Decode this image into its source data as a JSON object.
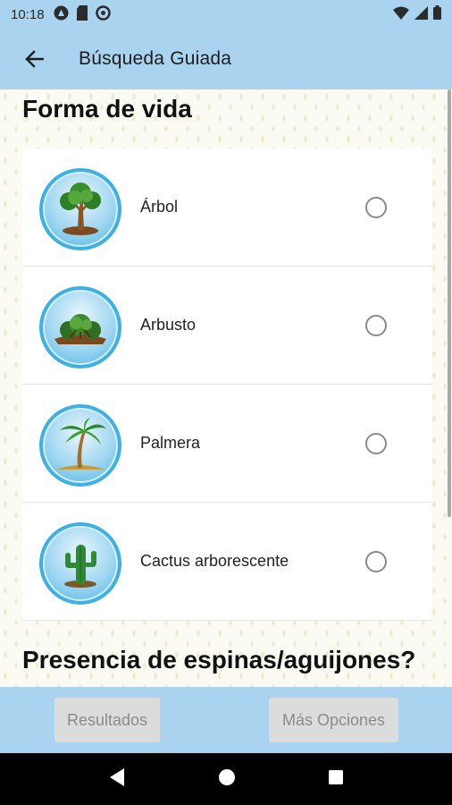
{
  "status_bar": {
    "time": "10:18",
    "left_icons": [
      "android-auto-icon",
      "sd-card-icon",
      "do-not-disturb-icon"
    ],
    "right_icons": [
      "wifi-icon",
      "signal-icon",
      "battery-icon"
    ]
  },
  "app_bar": {
    "title": "Búsqueda Guiada",
    "back_icon": "arrow-left-icon"
  },
  "sections": {
    "life_form_title": "Forma de vida",
    "thorns_title": "Presencia de espinas/aguijones?"
  },
  "options": [
    {
      "label": "Árbol",
      "icon": "tree-icon",
      "selected": false
    },
    {
      "label": "Arbusto",
      "icon": "shrub-icon",
      "selected": false
    },
    {
      "label": "Palmera",
      "icon": "palm-tree-icon",
      "selected": false
    },
    {
      "label": "Cactus arborescente",
      "icon": "cactus-icon",
      "selected": false
    }
  ],
  "buttons": {
    "results": "Resultados",
    "more_options": "Más Opciones"
  },
  "colors": {
    "app_bar": "#a9d3ee",
    "icon_ring": "#3fb0e2",
    "button_disabled_bg": "#dcdcdc",
    "button_disabled_text": "#8b8b8b"
  }
}
